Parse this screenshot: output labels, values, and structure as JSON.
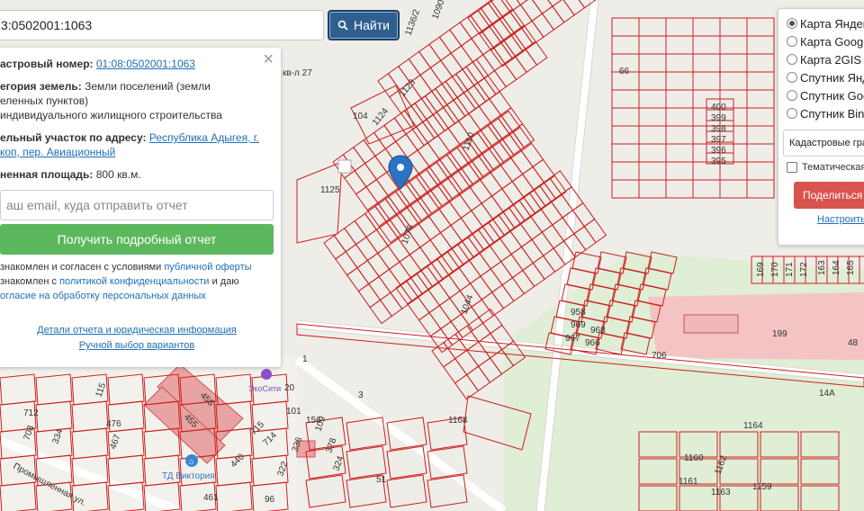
{
  "search": {
    "query": "3:0502001:1063",
    "button_label": "Найти"
  },
  "info": {
    "cadastral_label": "астровый номер:",
    "cadastral_value": "01:08:0502001:1063",
    "category_label": "егория земель:",
    "category_value_1": "Земли поселений (земли",
    "category_value_2": "еленных пунктов)",
    "use_line": "индивидуального жилищного строительства",
    "address_label": "ельный участок по адресу:",
    "address_value_1": "Республика Адыгея, г.",
    "address_value_2": "коп, пер. Авиационный",
    "area_label": "ненная площадь:",
    "area_value": "800 кв.м.",
    "email_placeholder": "аш email, куда отправить отчет",
    "report_button": "Получить подробный отчет",
    "agree_1_prefix": "знакомлен и согласен с условиями ",
    "agree_1_link": "публичной оферты",
    "agree_2_prefix": "знакомлен с ",
    "agree_2_link": "политикой конфиденциальности",
    "agree_2_suffix": " и даю",
    "agree_3_link": "огласие на обработку персональных данных",
    "details_link": "Детали отчета и юридическая информация",
    "manual_link": "Ручной выбор вариантов",
    "close_symbol": "×"
  },
  "layers": {
    "options": [
      {
        "label": "Карта Яндекс",
        "selected": true
      },
      {
        "label": "Карта Google",
        "selected": false
      },
      {
        "label": "Карта 2GIS",
        "selected": false
      },
      {
        "label": "Спутник Яндекс",
        "selected": false
      },
      {
        "label": "Спутник Google",
        "selected": false
      },
      {
        "label": "Спутник Bing",
        "selected": false
      }
    ],
    "overlay_select": "Кадастровые границы",
    "thematic_label": "Тематическая",
    "share_button": "Поделиться",
    "settings_link": "Настроить"
  },
  "map": {
    "plot_labels": [
      "1136/2",
      "1090",
      "1123",
      "1124",
      "1125",
      "1110",
      "1076",
      "1044",
      "400",
      "399",
      "398",
      "397",
      "396",
      "395",
      "958",
      "969",
      "968",
      "967",
      "966",
      "706",
      "199",
      "48",
      "169",
      "170",
      "171",
      "172",
      "163",
      "164",
      "165",
      "1164",
      "1164",
      "1160",
      "1161",
      "1162",
      "1163",
      "1159",
      "712",
      "708",
      "115",
      "476",
      "467",
      "334",
      "456",
      "455",
      "101",
      "156",
      "109",
      "378",
      "336",
      "322",
      "324",
      "715",
      "714",
      "440",
      "461",
      "96",
      "51",
      "3",
      "20",
      "1",
      "14А",
      "кв-л 27",
      "104",
      "66"
    ],
    "poi_label": "ТД Виктория",
    "poi_label_2": "ЭкоСити",
    "street_label": "Промышленная ул.",
    "accent_red": "#cc1f1f",
    "marker_color": "#2b72c4"
  }
}
